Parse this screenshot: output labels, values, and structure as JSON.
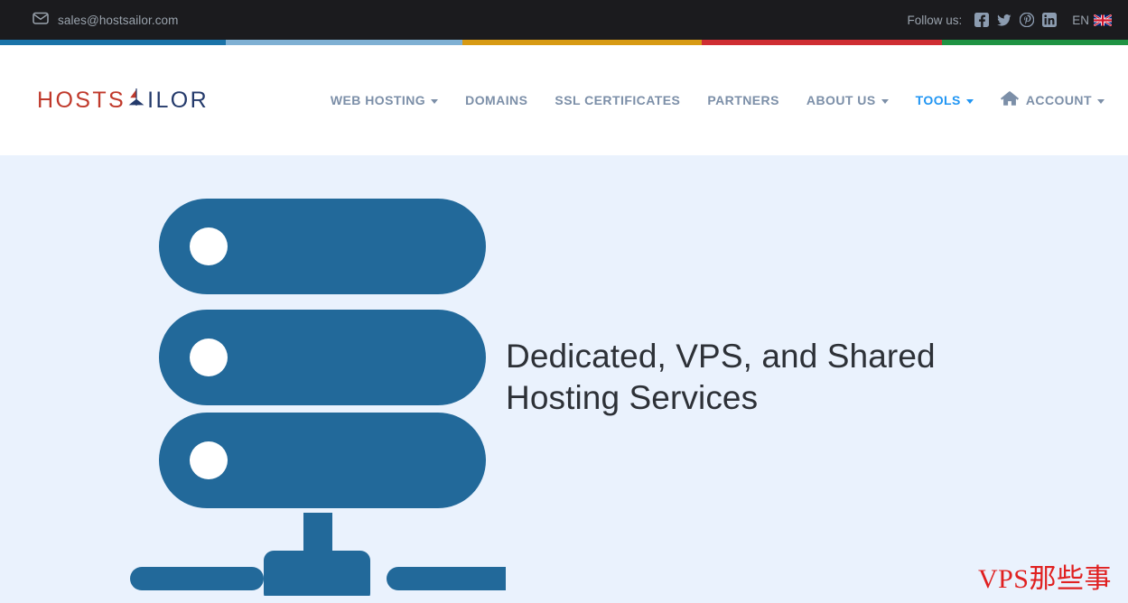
{
  "topbar": {
    "email": "sales@hostsailor.com",
    "email_icon": "envelope-icon",
    "follow_label": "Follow us:",
    "social": [
      {
        "name": "facebook-icon",
        "label": "Facebook"
      },
      {
        "name": "twitter-icon",
        "label": "Twitter"
      },
      {
        "name": "pinterest-icon",
        "label": "Pinterest"
      },
      {
        "name": "linkedin-icon",
        "label": "LinkedIn"
      }
    ],
    "language": {
      "code": "EN",
      "flag": "uk-flag-icon"
    },
    "bg": "#1b1b1e",
    "text_color": "#9aa3ad"
  },
  "stripe": [
    {
      "name": "stripe-blue",
      "color": "#1a73a8",
      "width": "20%"
    },
    {
      "name": "stripe-lightblue",
      "color": "#7fb0d3",
      "width": "21%"
    },
    {
      "name": "stripe-orange",
      "color": "#d79a14",
      "width": "21.2%"
    },
    {
      "name": "stripe-red",
      "color": "#cf2e33",
      "width": "21.3%"
    },
    {
      "name": "stripe-green",
      "color": "#1f9343",
      "width": "16.5%"
    }
  ],
  "logo": {
    "part_one": "HOSTS",
    "part_two": "ILOR",
    "mark": "sailboat-icon",
    "color_one": "#c0392b",
    "color_two": "#243a6b"
  },
  "nav": {
    "items": [
      {
        "label": "WEB HOSTING",
        "has_caret": true,
        "active": false,
        "icon": null
      },
      {
        "label": "DOMAINS",
        "has_caret": false,
        "active": false,
        "icon": null
      },
      {
        "label": "SSL CERTIFICATES",
        "has_caret": false,
        "active": false,
        "icon": null
      },
      {
        "label": "PARTNERS",
        "has_caret": false,
        "active": false,
        "icon": null
      },
      {
        "label": "ABOUT US",
        "has_caret": true,
        "active": false,
        "icon": null
      },
      {
        "label": "TOOLS",
        "has_caret": true,
        "active": true,
        "icon": null
      },
      {
        "label": "ACCOUNT",
        "has_caret": true,
        "active": false,
        "icon": "home-icon"
      }
    ],
    "color": "#7c8fa8",
    "active_color": "#2196f3"
  },
  "hero": {
    "title": "Dedicated, VPS, and Shared Hosting Services",
    "background": "#eaf2fd",
    "title_color": "#2d3137",
    "illustration": {
      "name": "server-rack-illustration",
      "color": "#22699a",
      "dot_color": "#ffffff",
      "rack_count": 3
    }
  },
  "watermark": {
    "text": "VPS那些事",
    "color": "#e02020"
  }
}
